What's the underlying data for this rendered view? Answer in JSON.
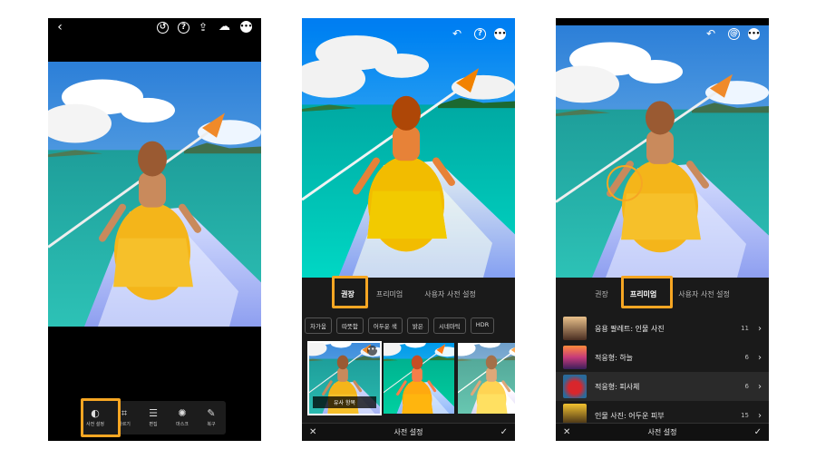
{
  "colors": {
    "highlight": "#f6a623",
    "panel_bg": "#1a1a1a",
    "toolbar_bg": "#1c1c1c"
  },
  "phone1": {
    "topbar": {
      "back_icon": "chevron-left-icon",
      "icons": [
        "history-icon",
        "help-icon",
        "share-icon",
        "cloud-sync-icon",
        "more-icon"
      ]
    },
    "toolbar": [
      {
        "label": "사전 설정",
        "icon": "presets-icon"
      },
      {
        "label": "자르기",
        "icon": "crop-icon"
      },
      {
        "label": "편집",
        "icon": "edit-icon"
      },
      {
        "label": "마스크",
        "icon": "mask-icon"
      },
      {
        "label": "복구",
        "icon": "heal-icon"
      }
    ]
  },
  "phone2": {
    "tabs": [
      "권장",
      "프리미엄",
      "사용자 사전 설정"
    ],
    "active_tab": "권장",
    "chips": [
      "차가움",
      "따뜻함",
      "어두운 색",
      "밝은",
      "시네마틱",
      "HDR"
    ],
    "thumb_badge": "유사 항목",
    "thumb_more": "•••",
    "bottom_title": "사전 설정",
    "cancel": "✕",
    "confirm": "✓"
  },
  "phone3": {
    "tabs": [
      "권장",
      "프리미엄",
      "사용자 사전 설정"
    ],
    "active_tab": "프리미엄",
    "rows": [
      {
        "label": "응용 팔레트: 인물 사진",
        "count": "11"
      },
      {
        "label": "적응형: 하늘",
        "count": "6"
      },
      {
        "label": "적응형: 피사체",
        "count": "6"
      },
      {
        "label": "인물 사진: 어두운 피부",
        "count": "15"
      }
    ],
    "bottom_title": "사전 설정",
    "cancel": "✕",
    "confirm": "✓"
  }
}
